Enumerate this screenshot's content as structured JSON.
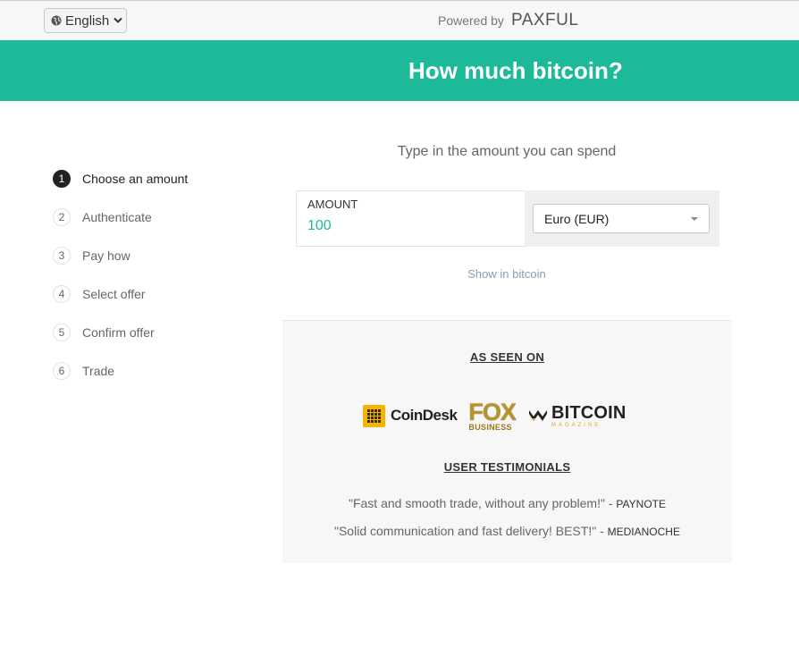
{
  "header": {
    "language_label": "English",
    "powered_by": "Powered by",
    "brand": "PAXFUL"
  },
  "banner": {
    "title": "How much bitcoin?"
  },
  "steps": [
    {
      "num": "1",
      "label": "Choose an amount",
      "active": true
    },
    {
      "num": "2",
      "label": "Authenticate",
      "active": false
    },
    {
      "num": "3",
      "label": "Pay how",
      "active": false
    },
    {
      "num": "4",
      "label": "Select offer",
      "active": false
    },
    {
      "num": "5",
      "label": "Confirm offer",
      "active": false
    },
    {
      "num": "6",
      "label": "Trade",
      "active": false
    }
  ],
  "form": {
    "instruction": "Type in the amount you can spend",
    "amount_label": "AMOUNT",
    "amount_value": "100",
    "currency": "Euro (EUR)",
    "show_in_bitcoin": "Show in bitcoin"
  },
  "seen_on": {
    "title": "AS SEEN ON",
    "logos": {
      "coindesk": "CoinDesk",
      "fox_top": "FOX",
      "fox_bottom": "BUSINESS",
      "btc_top": "BITCOIN",
      "btc_bottom": "MAGAZINE"
    }
  },
  "testimonials": {
    "title": "USER TESTIMONIALS",
    "items": [
      {
        "quote": "\"Fast and smooth trade, without any problem!\"",
        "sep": " - ",
        "author": "PAYNOTE"
      },
      {
        "quote": "\"Solid communication and fast delivery! BEST!\"",
        "sep": " - ",
        "author": "MEDIANOCHE"
      }
    ]
  },
  "colors": {
    "accent": "#1dba9a",
    "banner_text": "#ffffff",
    "coindesk_yellow": "#f5b400"
  }
}
